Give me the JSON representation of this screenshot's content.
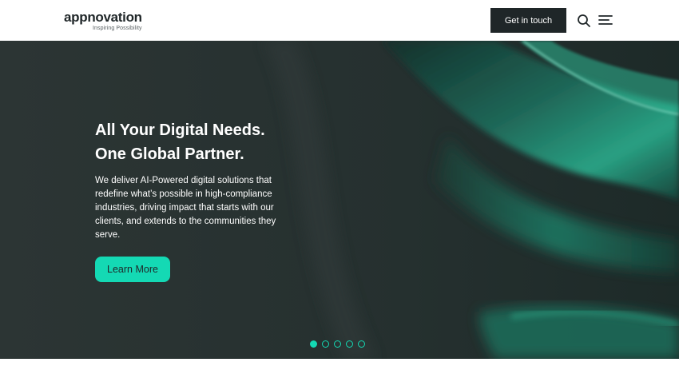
{
  "brand": {
    "name": "appnovation",
    "tagline": "Inspiring Possibility"
  },
  "header": {
    "cta_label": "Get in touch",
    "icons": [
      "search-icon",
      "hamburger-menu-icon"
    ]
  },
  "hero": {
    "headline_line1": "All Your Digital Needs.",
    "headline_line2": "One Global Partner.",
    "description": "We deliver AI-Powered digital solutions that redefine what’s possible in high-compliance industries, driving impact that starts with our clients, and extends to the communities they serve.",
    "button_label": "Learn More",
    "slides_total": 5,
    "slide_active": 1
  },
  "colors": {
    "accent": "#14d9b4",
    "dark": "#1f2628",
    "hero_bg": "#2a3332"
  }
}
